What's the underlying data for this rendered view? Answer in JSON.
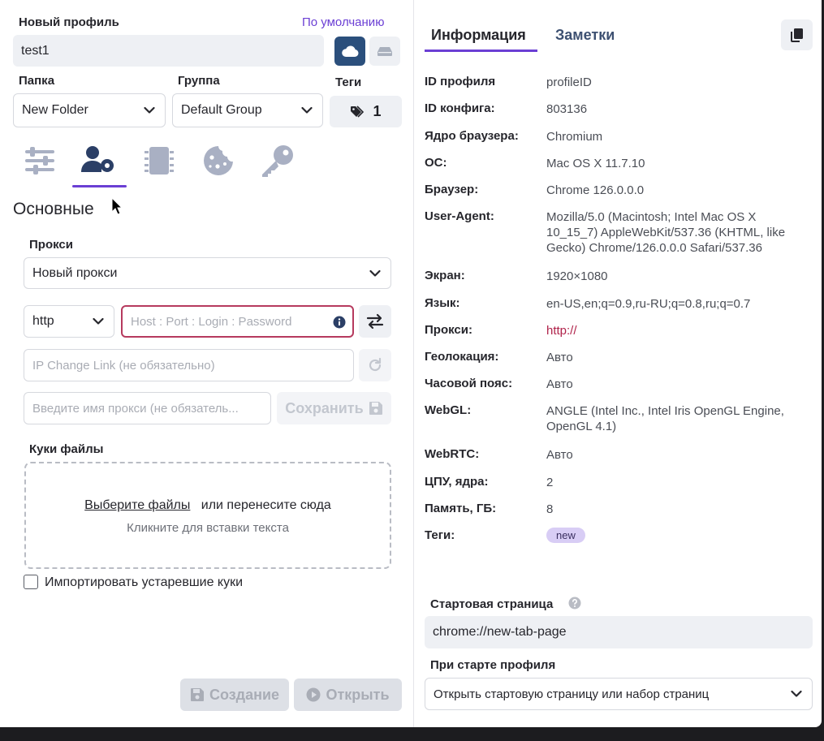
{
  "left": {
    "profile_label": "Новый профиль",
    "default_link": "По умолчанию",
    "profile_name": "test1",
    "folder_label": "Папка",
    "folder_value": "New Folder",
    "group_label": "Группа",
    "group_value": "Default Group",
    "tags_label": "Теги",
    "tags_count": "1",
    "section_title": "Основные",
    "proxy_label": "Прокси",
    "proxy_select": "Новый прокси",
    "protocol": "http",
    "host_placeholder": "Host : Port : Login : Password",
    "ip_change_placeholder": "IP Change Link (не обязательно)",
    "proxy_name_placeholder": "Введите имя прокси (не обязатель...",
    "save_label": "Сохранить",
    "cookies_label": "Куки файлы",
    "choose_files": "Выберите файлы",
    "or_drop": "или перенесите сюда",
    "click_paste": "Кликните для вставки текста",
    "import_old": "Импортировать устаревшие куки",
    "create_label": "Создание",
    "open_label": "Открыть"
  },
  "right": {
    "tabs": [
      {
        "label": "Информация",
        "active": true
      },
      {
        "label": "Заметки",
        "active": false
      }
    ],
    "info": [
      {
        "key": "ID профиля",
        "value": "profileID"
      },
      {
        "key": "ID конфига:",
        "value": "803136"
      },
      {
        "key": "Ядро браузера:",
        "value": "Chromium"
      },
      {
        "key": "ОС:",
        "value": "Mac OS X 11.7.10"
      },
      {
        "key": "Браузер:",
        "value": "Chrome 126.0.0.0"
      },
      {
        "key": "User-Agent:",
        "value": "Mozilla/5.0 (Macintosh; Intel Mac OS X 10_15_7) AppleWebKit/537.36 (KHTML, like Gecko) Chrome/126.0.0.0 Safari/537.36"
      },
      {
        "key": "Экран:",
        "value": "1920×1080"
      },
      {
        "key": "Язык:",
        "value": "en-US,en;q=0.9,ru-RU;q=0.8,ru;q=0.7"
      },
      {
        "key": "Прокси:",
        "value": "http://"
      },
      {
        "key": "Геолокация:",
        "value": "Авто"
      },
      {
        "key": "Часовой пояс:",
        "value": "Авто"
      },
      {
        "key": "WebGL:",
        "value": "ANGLE (Intel Inc., Intel Iris OpenGL Engine, OpenGL 4.1)"
      },
      {
        "key": "WebRTC:",
        "value": "Авто"
      },
      {
        "key": "ЦПУ, ядра:",
        "value": "2"
      },
      {
        "key": "Память, ГБ:",
        "value": "8"
      },
      {
        "key": "Теги:",
        "value": "new"
      }
    ],
    "start_page_label": "Стартовая страница",
    "start_page_value": "chrome://new-tab-page",
    "on_start_label": "При старте профиля",
    "on_start_value": "Открыть стартовую страницу или набор страниц"
  },
  "colors": {
    "accent": "#6b3fd4",
    "proxy_link": "#b0224a",
    "input_error_border": "#b63a5e",
    "field_bg": "#eef0f4",
    "tag_bg": "#d8cdf5"
  },
  "icons": [
    "cloud-icon",
    "hdd-icon",
    "tag-icon",
    "sliders-icon",
    "user-gear-icon",
    "chip-icon",
    "cookie-icon",
    "key-icon",
    "info-icon",
    "swap-icon",
    "refresh-icon",
    "save-icon",
    "play-icon",
    "copy-icon",
    "help-icon",
    "chevron-down-icon"
  ]
}
